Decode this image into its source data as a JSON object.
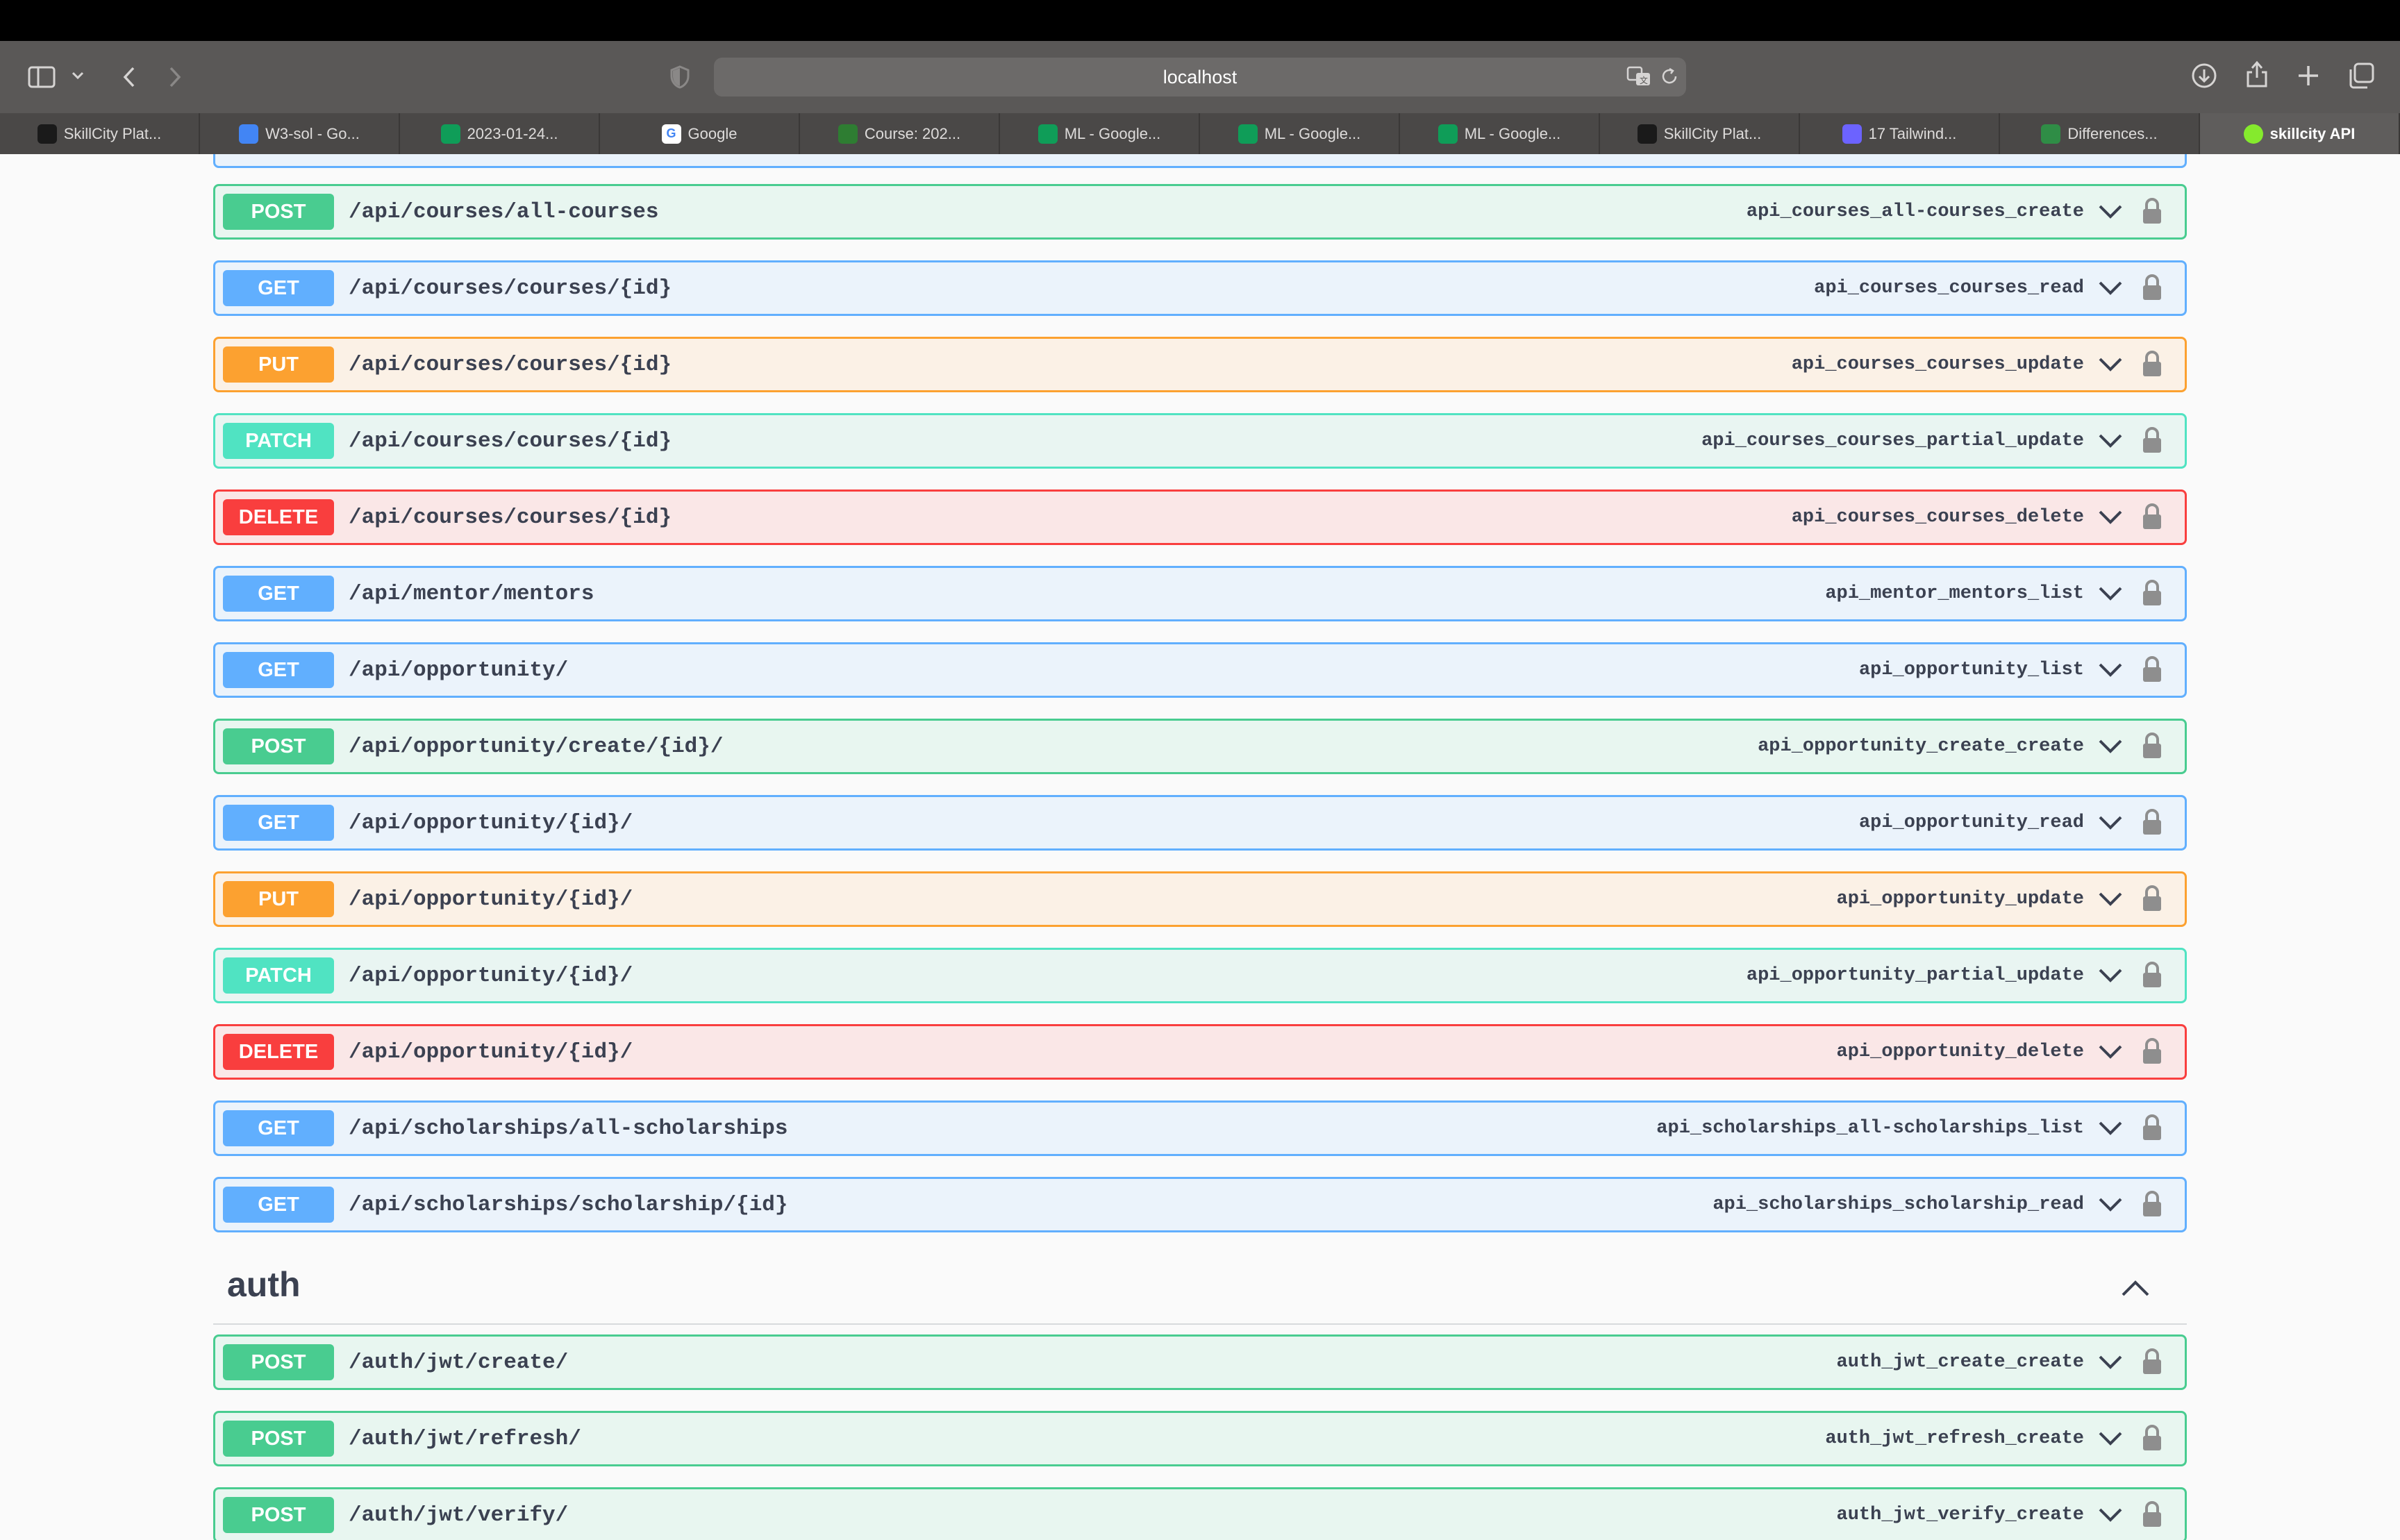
{
  "browser": {
    "url": "localhost",
    "tabs": [
      {
        "label": "SkillCity Plat...",
        "icon": "skillcity-icon",
        "color": "#1a1a1a"
      },
      {
        "label": "W3-sol - Go...",
        "icon": "docs-icon",
        "color": "#4285f4"
      },
      {
        "label": "2023-01-24...",
        "icon": "drive-icon",
        "color": "#0f9d58"
      },
      {
        "label": "Google",
        "icon": "google-icon",
        "color": "#ffffff"
      },
      {
        "label": "Course: 202...",
        "icon": "course-icon",
        "color": "#2e7d32"
      },
      {
        "label": "ML - Google...",
        "icon": "drive-icon",
        "color": "#0f9d58"
      },
      {
        "label": "ML - Google...",
        "icon": "drive-icon",
        "color": "#0f9d58"
      },
      {
        "label": "ML - Google...",
        "icon": "drive-icon",
        "color": "#0f9d58"
      },
      {
        "label": "SkillCity Plat...",
        "icon": "skillcity-icon",
        "color": "#1a1a1a"
      },
      {
        "label": "17 Tailwind...",
        "icon": "code-icon",
        "color": "#6c63ff"
      },
      {
        "label": "Differences...",
        "icon": "gfg-icon",
        "color": "#2f8d46"
      },
      {
        "label": "skillcity API",
        "icon": "swagger-icon",
        "color": "#85ea2d",
        "active": true
      }
    ]
  },
  "colors": {
    "POST": {
      "badge": "#49cc90",
      "border": "#49cc90",
      "bg": "#e8f6f0"
    },
    "GET": {
      "badge": "#61affe",
      "border": "#61affe",
      "bg": "#ebf3fb"
    },
    "PUT": {
      "badge": "#fca130",
      "border": "#fca130",
      "bg": "#fbf1e6"
    },
    "PATCH": {
      "badge": "#50e3c2",
      "border": "#50e3c2",
      "bg": "#e9f5f2"
    },
    "DELETE": {
      "badge": "#f93e3e",
      "border": "#f93e3e",
      "bg": "#fae7e7"
    }
  },
  "operations": [
    {
      "method": "POST",
      "path": "/api/courses/all-courses",
      "operation_id": "api_courses_all-courses_create"
    },
    {
      "method": "GET",
      "path": "/api/courses/courses/{id}",
      "operation_id": "api_courses_courses_read"
    },
    {
      "method": "PUT",
      "path": "/api/courses/courses/{id}",
      "operation_id": "api_courses_courses_update"
    },
    {
      "method": "PATCH",
      "path": "/api/courses/courses/{id}",
      "operation_id": "api_courses_courses_partial_update"
    },
    {
      "method": "DELETE",
      "path": "/api/courses/courses/{id}",
      "operation_id": "api_courses_courses_delete"
    },
    {
      "method": "GET",
      "path": "/api/mentor/mentors",
      "operation_id": "api_mentor_mentors_list"
    },
    {
      "method": "GET",
      "path": "/api/opportunity/",
      "operation_id": "api_opportunity_list"
    },
    {
      "method": "POST",
      "path": "/api/opportunity/create/{id}/",
      "operation_id": "api_opportunity_create_create"
    },
    {
      "method": "GET",
      "path": "/api/opportunity/{id}/",
      "operation_id": "api_opportunity_read"
    },
    {
      "method": "PUT",
      "path": "/api/opportunity/{id}/",
      "operation_id": "api_opportunity_update"
    },
    {
      "method": "PATCH",
      "path": "/api/opportunity/{id}/",
      "operation_id": "api_opportunity_partial_update"
    },
    {
      "method": "DELETE",
      "path": "/api/opportunity/{id}/",
      "operation_id": "api_opportunity_delete"
    },
    {
      "method": "GET",
      "path": "/api/scholarships/all-scholarships",
      "operation_id": "api_scholarships_all-scholarships_list"
    },
    {
      "method": "GET",
      "path": "/api/scholarships/scholarship/{id}",
      "operation_id": "api_scholarships_scholarship_read"
    }
  ],
  "auth_section": {
    "title": "auth",
    "operations": [
      {
        "method": "POST",
        "path": "/auth/jwt/create/",
        "operation_id": "auth_jwt_create_create"
      },
      {
        "method": "POST",
        "path": "/auth/jwt/refresh/",
        "operation_id": "auth_jwt_refresh_create"
      },
      {
        "method": "POST",
        "path": "/auth/jwt/verify/",
        "operation_id": "auth_jwt_verify_create"
      }
    ]
  }
}
